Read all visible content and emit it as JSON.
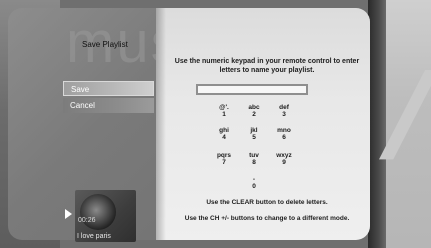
{
  "screen": {
    "watermark": "music",
    "title": "Save Playlist"
  },
  "menu": {
    "items": [
      {
        "label": "Save",
        "state": "selected"
      },
      {
        "label": "Cancel",
        "state": "normal"
      }
    ]
  },
  "instructions": {
    "main": "Use the numeric keypad in your remote control to enter letters to name your playlist.",
    "clear_hint": "Use the CLEAR button to delete letters.",
    "ch_hint": "Use the CH +/- buttons to change to a different mode."
  },
  "name_field": {
    "value": ""
  },
  "keypad": {
    "keys": [
      {
        "letters": "@'.",
        "digit": "1"
      },
      {
        "letters": "abc",
        "digit": "2"
      },
      {
        "letters": "def",
        "digit": "3"
      },
      {
        "letters": "ghi",
        "digit": "4"
      },
      {
        "letters": "jkl",
        "digit": "5"
      },
      {
        "letters": "mno",
        "digit": "6"
      },
      {
        "letters": "pqrs",
        "digit": "7"
      },
      {
        "letters": "tuv",
        "digit": "8"
      },
      {
        "letters": "wxyz",
        "digit": "9"
      },
      {
        "letters": "-",
        "digit": "0"
      }
    ]
  },
  "now_playing": {
    "time": "00:26",
    "song": "I love paris",
    "icon": "play-icon"
  },
  "colors": {
    "accent": "#cfcfcf",
    "panel": "#7a7a7a",
    "content_bg": "#e8e8e8"
  }
}
